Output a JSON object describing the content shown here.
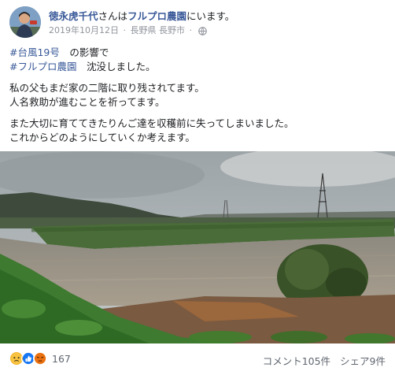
{
  "post": {
    "author": "徳永虎千代",
    "author_suffix": "さんは",
    "place": "フルプロ農園",
    "place_suffix": "にいます。",
    "date": "2019年10月12日",
    "location": "長野県 長野市",
    "separator": "·",
    "privacy_icon": "globe-icon",
    "hashtag_1": "#台風19号",
    "line_1_rest": "　の影響で",
    "hashtag_2": "#フルプロ農園",
    "line_2_rest": "　沈没しました。",
    "line_3": "私の父もまだ家の二階に取り残されてます。",
    "line_4": "人名救助が進むことを祈ってます。",
    "line_5": "また大切に育ててきたりんご達を収穫前に失ってしまいました。",
    "line_6": "これからどのようにしていくか考えます。"
  },
  "footer": {
    "reaction_icons": [
      "sad-icon",
      "like-icon",
      "angry-icon"
    ],
    "reaction_count": "167",
    "comments": "コメント105件",
    "shares": "シェア9件"
  },
  "colors": {
    "link": "#385898",
    "meta": "#90949c",
    "text": "#1c1e21"
  }
}
